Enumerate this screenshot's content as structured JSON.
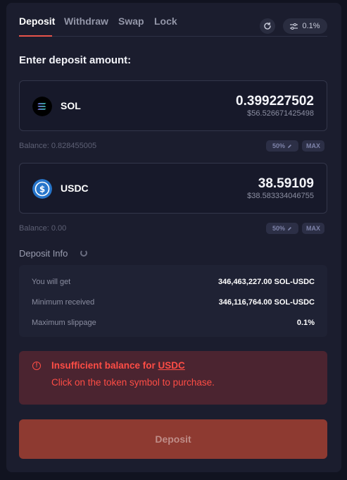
{
  "tabs": [
    {
      "label": "Deposit",
      "active": true
    },
    {
      "label": "Withdraw",
      "active": false
    },
    {
      "label": "Swap",
      "active": false
    },
    {
      "label": "Lock",
      "active": false
    }
  ],
  "slippage_setting": "0.1%",
  "heading": "Enter deposit amount:",
  "tokens": [
    {
      "symbol": "SOL",
      "amount": "0.399227502",
      "usd_value": "$56.526671425498",
      "balance": "Balance: 0.828455005",
      "half_label": "50%",
      "max_label": "MAX",
      "icon": "solana-logo-icon"
    },
    {
      "symbol": "USDC",
      "amount": "38.59109",
      "usd_value": "$38.583334046755",
      "balance": "Balance: 0.00",
      "half_label": "50%",
      "max_label": "MAX",
      "icon": "usdc-logo-icon"
    }
  ],
  "deposit_info": {
    "title": "Deposit Info",
    "rows": [
      {
        "label": "You will get",
        "value": "346,463,227.00 SOL-USDC"
      },
      {
        "label": "Minimum received",
        "value": "346,116,764.00 SOL-USDC"
      },
      {
        "label": "Maximum slippage",
        "value": "0.1%"
      }
    ]
  },
  "error": {
    "title_prefix": "Insufficient balance for",
    "token_link": "USDC",
    "subtitle": "Click on the token symbol to purchase."
  },
  "deposit_button": "Deposit",
  "colors": {
    "accent": "#e8534a",
    "error": "#ff4d45",
    "background": "#1b1d2e",
    "button": "#8e3a31",
    "usdc_blue": "#2775ca"
  }
}
